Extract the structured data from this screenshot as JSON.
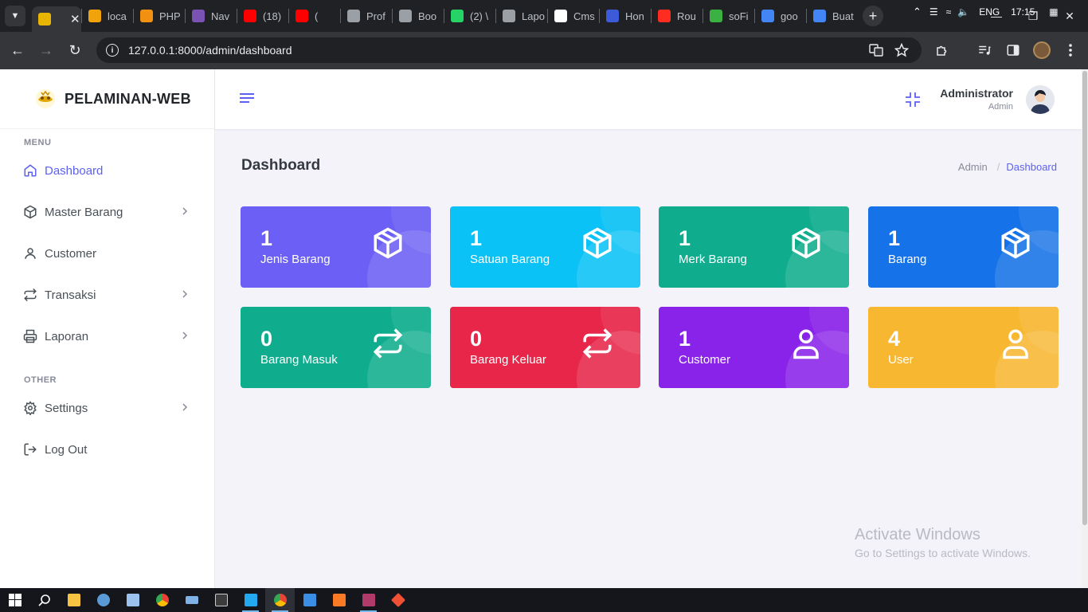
{
  "browser": {
    "tabs": [
      {
        "label": "",
        "active": true,
        "color": "#e8b600"
      },
      {
        "label": "loca",
        "color": "#f0a30a"
      },
      {
        "label": "PHP",
        "color": "#f29111"
      },
      {
        "label": "Nav",
        "color": "#7952b3"
      },
      {
        "label": "(18)",
        "color": "#ff0000"
      },
      {
        "label": "(",
        "color": "#ff0000"
      },
      {
        "label": "Prof",
        "color": "#9aa0a6"
      },
      {
        "label": "Boo",
        "color": "#9aa0a6"
      },
      {
        "label": "(2) \\",
        "color": "#25d366"
      },
      {
        "label": "Lapo",
        "color": "#9aa0a6"
      },
      {
        "label": "Cms",
        "color": "#ffffff"
      },
      {
        "label": "Hon",
        "color": "#3b5bdb"
      },
      {
        "label": "Rou",
        "color": "#ff2d20"
      },
      {
        "label": "soFi",
        "color": "#3bb143"
      },
      {
        "label": "goo",
        "color": "#4285f4"
      },
      {
        "label": "Buat",
        "color": "#4285f4"
      }
    ],
    "url": "127.0.0.1:8000/admin/dashboard"
  },
  "app": {
    "brand": "PELAMINAN-WEB",
    "user_name": "Administrator",
    "user_role": "Admin"
  },
  "sidebar": {
    "menu_title": "MENU",
    "other_title": "OTHER",
    "items": [
      {
        "label": "Dashboard",
        "icon": "home-icon",
        "active": true,
        "has_children": false
      },
      {
        "label": "Master Barang",
        "icon": "box-icon",
        "has_children": true
      },
      {
        "label": "Customer",
        "icon": "user-icon",
        "has_children": false
      },
      {
        "label": "Transaksi",
        "icon": "repeat-icon",
        "has_children": true
      },
      {
        "label": "Laporan",
        "icon": "printer-icon",
        "has_children": true
      }
    ],
    "other_items": [
      {
        "label": "Settings",
        "icon": "gear-icon",
        "has_children": true
      },
      {
        "label": "Log Out",
        "icon": "logout-icon",
        "has_children": false
      }
    ]
  },
  "main": {
    "title": "Dashboard",
    "breadcrumb": [
      "Admin",
      "Dashboard"
    ]
  },
  "cards": [
    {
      "value": "1",
      "label": "Jenis Barang",
      "icon": "box-icon",
      "color": "#6b5ff5"
    },
    {
      "value": "1",
      "label": "Satuan Barang",
      "icon": "box-icon",
      "color": "#0ac2f5"
    },
    {
      "value": "1",
      "label": "Merk Barang",
      "icon": "box-icon",
      "color": "#0fad8e"
    },
    {
      "value": "1",
      "label": "Barang",
      "icon": "box-icon",
      "color": "#1572e8"
    },
    {
      "value": "0",
      "label": "Barang Masuk",
      "icon": "repeat-icon",
      "color": "#0fad8e"
    },
    {
      "value": "0",
      "label": "Barang Keluar",
      "icon": "repeat-icon",
      "color": "#e8264a"
    },
    {
      "value": "1",
      "label": "Customer",
      "icon": "user-icon",
      "color": "#8a23ea"
    },
    {
      "value": "4",
      "label": "User",
      "icon": "user-icon",
      "color": "#f7b731"
    }
  ],
  "watermark": {
    "line1": "Activate Windows",
    "line2": "Go to Settings to activate Windows."
  },
  "taskbar": {
    "language": "ENG",
    "time": "17:15"
  },
  "colors": {
    "accent": "#5c61f2"
  }
}
